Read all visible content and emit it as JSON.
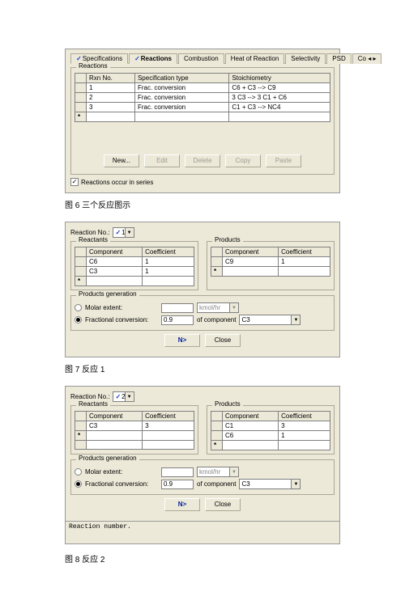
{
  "fig6": {
    "tabs": {
      "specifications": "Specifications",
      "reactions": "Reactions",
      "combustion": "Combustion",
      "heat": "Heat of Reaction",
      "selectivity": "Selectivity",
      "psd": "PSD",
      "co": "Co"
    },
    "group_title": "Reactions",
    "headers": {
      "rxn": "Rxn No.",
      "spec": "Specification type",
      "stoi": "Stoichiometry"
    },
    "rows": [
      {
        "n": "1",
        "spec": "Frac. conversion",
        "stoi": "C6 + C3 -->  C9"
      },
      {
        "n": "2",
        "spec": "Frac. conversion",
        "stoi": "3 C3 -->  3 C1 + C6"
      },
      {
        "n": "3",
        "spec": "Frac. conversion",
        "stoi": "C1 + C3 -->  NC4"
      }
    ],
    "buttons": {
      "new": "New...",
      "edit": "Edit",
      "delete": "Delete",
      "copy": "Copy",
      "paste": "Paste"
    },
    "checkbox_label": "Reactions occur in series",
    "caption": "图 6 三个反应图示"
  },
  "fig7": {
    "reaction_no_label": "Reaction No.:",
    "reaction_no_value": "1",
    "reactants_title": "Reactants",
    "products_title": "Products",
    "col_component": "Component",
    "col_coeff": "Coefficient",
    "reactants": [
      {
        "comp": "C6",
        "coef": "1"
      },
      {
        "comp": "C3",
        "coef": "1"
      }
    ],
    "products": [
      {
        "comp": "C9",
        "coef": "1"
      }
    ],
    "gen_title": "Products generation",
    "molar_label": "Molar extent:",
    "molar_unit": "kmol/hr",
    "frac_label": "Fractional conversion:",
    "frac_value": "0.9",
    "of_comp_label": "of component",
    "of_comp_value": "C3",
    "next_btn": "N>",
    "close_btn": "Close",
    "caption": "图 7 反应 1"
  },
  "fig8": {
    "reaction_no_label": "Reaction No.:",
    "reaction_no_value": "2",
    "reactants_title": "Reactants",
    "products_title": "Products",
    "col_component": "Component",
    "col_coeff": "Coefficient",
    "reactants": [
      {
        "comp": "C3",
        "coef": "3"
      }
    ],
    "products": [
      {
        "comp": "C1",
        "coef": "3"
      },
      {
        "comp": "C6",
        "coef": "1"
      }
    ],
    "gen_title": "Products generation",
    "molar_label": "Molar extent:",
    "molar_unit": "kmol/hr",
    "frac_label": "Fractional conversion:",
    "frac_value": "0.9",
    "of_comp_label": "of component",
    "of_comp_value": "C3",
    "next_btn": "N>",
    "close_btn": "Close",
    "status": "Reaction number.",
    "caption": "图 8 反应 2"
  }
}
